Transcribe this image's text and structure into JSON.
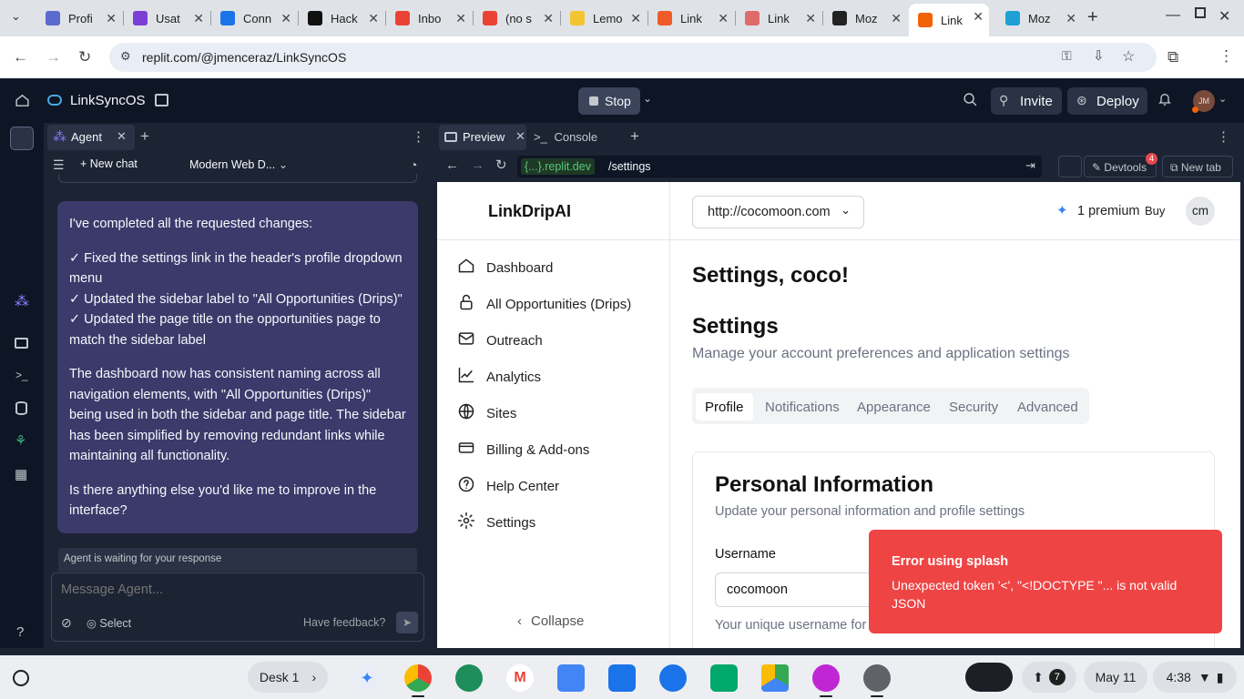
{
  "browser": {
    "tabs": [
      {
        "title": "Profi",
        "color": "#5a6acf"
      },
      {
        "title": "Usat",
        "color": "#7b3fd6"
      },
      {
        "title": "Conn",
        "color": "#1a73e8"
      },
      {
        "title": "Hack",
        "color": "#111111"
      },
      {
        "title": "Inbo",
        "color": "#ea4335"
      },
      {
        "title": "(no s",
        "color": "#ea4335"
      },
      {
        "title": "Lemo",
        "color": "#f4c430"
      },
      {
        "title": "Link",
        "color": "#f05a28"
      },
      {
        "title": "Link",
        "color": "#e06b6b"
      },
      {
        "title": "Moz",
        "color": "#222222"
      },
      {
        "title": "Link",
        "color": "#f26207"
      },
      {
        "title": "Moz",
        "color": "#1ea0d6"
      }
    ],
    "url": "replit.com/@jmenceraz/LinkSyncOS"
  },
  "replit": {
    "project": "LinkSyncOS",
    "stop_label": "Stop",
    "invite_label": "Invite",
    "deploy_label": "Deploy",
    "avatar": "JM"
  },
  "agent": {
    "tab_label": "Agent",
    "new_chat": "New chat",
    "model": "Modern Web D...",
    "message": {
      "intro": "I've completed all the requested changes:",
      "items": [
        "✓ Fixed the settings link in the header's profile dropdown menu",
        "✓ Updated the sidebar label to \"All Opportunities (Drips)\"",
        "✓ Updated the page title on the opportunities page to match the sidebar label"
      ],
      "para": "The dashboard now has consistent naming across all navigation elements, with \"All Opportunities (Drips)\" being used in both the sidebar and page title. The sidebar has been simplified by removing redundant links while maintaining all functionality.",
      "question": "Is there anything else you'd like me to improve in the interface?"
    },
    "waiting": "Agent is waiting for your response",
    "input_placeholder": "Message Agent...",
    "select_label": "Select",
    "feedback_label": "Have feedback?"
  },
  "preview": {
    "tab_preview": "Preview",
    "tab_console": "Console",
    "url_domain": "{...}.replit.dev",
    "url_path": "/settings",
    "devtools_label": "Devtools",
    "devtools_badge": "4",
    "newtab_label": "New tab"
  },
  "app": {
    "brand": "LinkDripAI",
    "site_select": "http://cocomoon.com",
    "premium_label": "1 premium",
    "buy_label": "Buy",
    "user_initials": "cm",
    "nav": [
      {
        "label": "Dashboard",
        "icon": "home-icon"
      },
      {
        "label": "All Opportunities (Drips)",
        "icon": "lock-icon"
      },
      {
        "label": "Outreach",
        "icon": "mail-icon"
      },
      {
        "label": "Analytics",
        "icon": "chart-icon"
      },
      {
        "label": "Sites",
        "icon": "globe-icon"
      },
      {
        "label": "Billing & Add-ons",
        "icon": "card-icon"
      },
      {
        "label": "Help Center",
        "icon": "help-icon"
      },
      {
        "label": "Settings",
        "icon": "gear-icon"
      }
    ],
    "collapse_label": "Collapse",
    "greeting": "Settings, coco!",
    "settings_title": "Settings",
    "settings_subtitle": "Manage your account preferences and application settings",
    "tabs": [
      "Profile",
      "Notifications",
      "Appearance",
      "Security",
      "Advanced"
    ],
    "card_title": "Personal Information",
    "card_subtitle": "Update your personal information and profile settings",
    "username_label": "Username",
    "username_value": "cocomoon",
    "username_help": "Your unique username for",
    "toast_title": "Error using splash",
    "toast_body": "Unexpected token '<', \"<!DOCTYPE \"... is not valid JSON"
  },
  "shelf": {
    "desk_label": "Desk 1",
    "notif_count": "7",
    "date": "May 11",
    "time": "4:38"
  }
}
